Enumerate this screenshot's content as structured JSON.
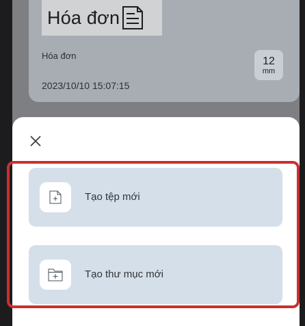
{
  "background_file": {
    "thumbnail_text": "Hóa đơn",
    "thumbnail_icon": "document-lines-icon",
    "name": "Hóa đơn",
    "date": "2023/10/10 15:07:15",
    "size_value": "12",
    "size_unit": "mm"
  },
  "sheet": {
    "close_icon": "close-icon",
    "actions": [
      {
        "label": "Tạo tệp mới",
        "icon": "new-file-icon"
      },
      {
        "label": "Tạo thư mục mới",
        "icon": "new-folder-icon"
      }
    ]
  },
  "colors": {
    "highlight": "#cc2f2f",
    "action_bg": "#d5dfe9",
    "backdrop": "#7e7f83"
  }
}
